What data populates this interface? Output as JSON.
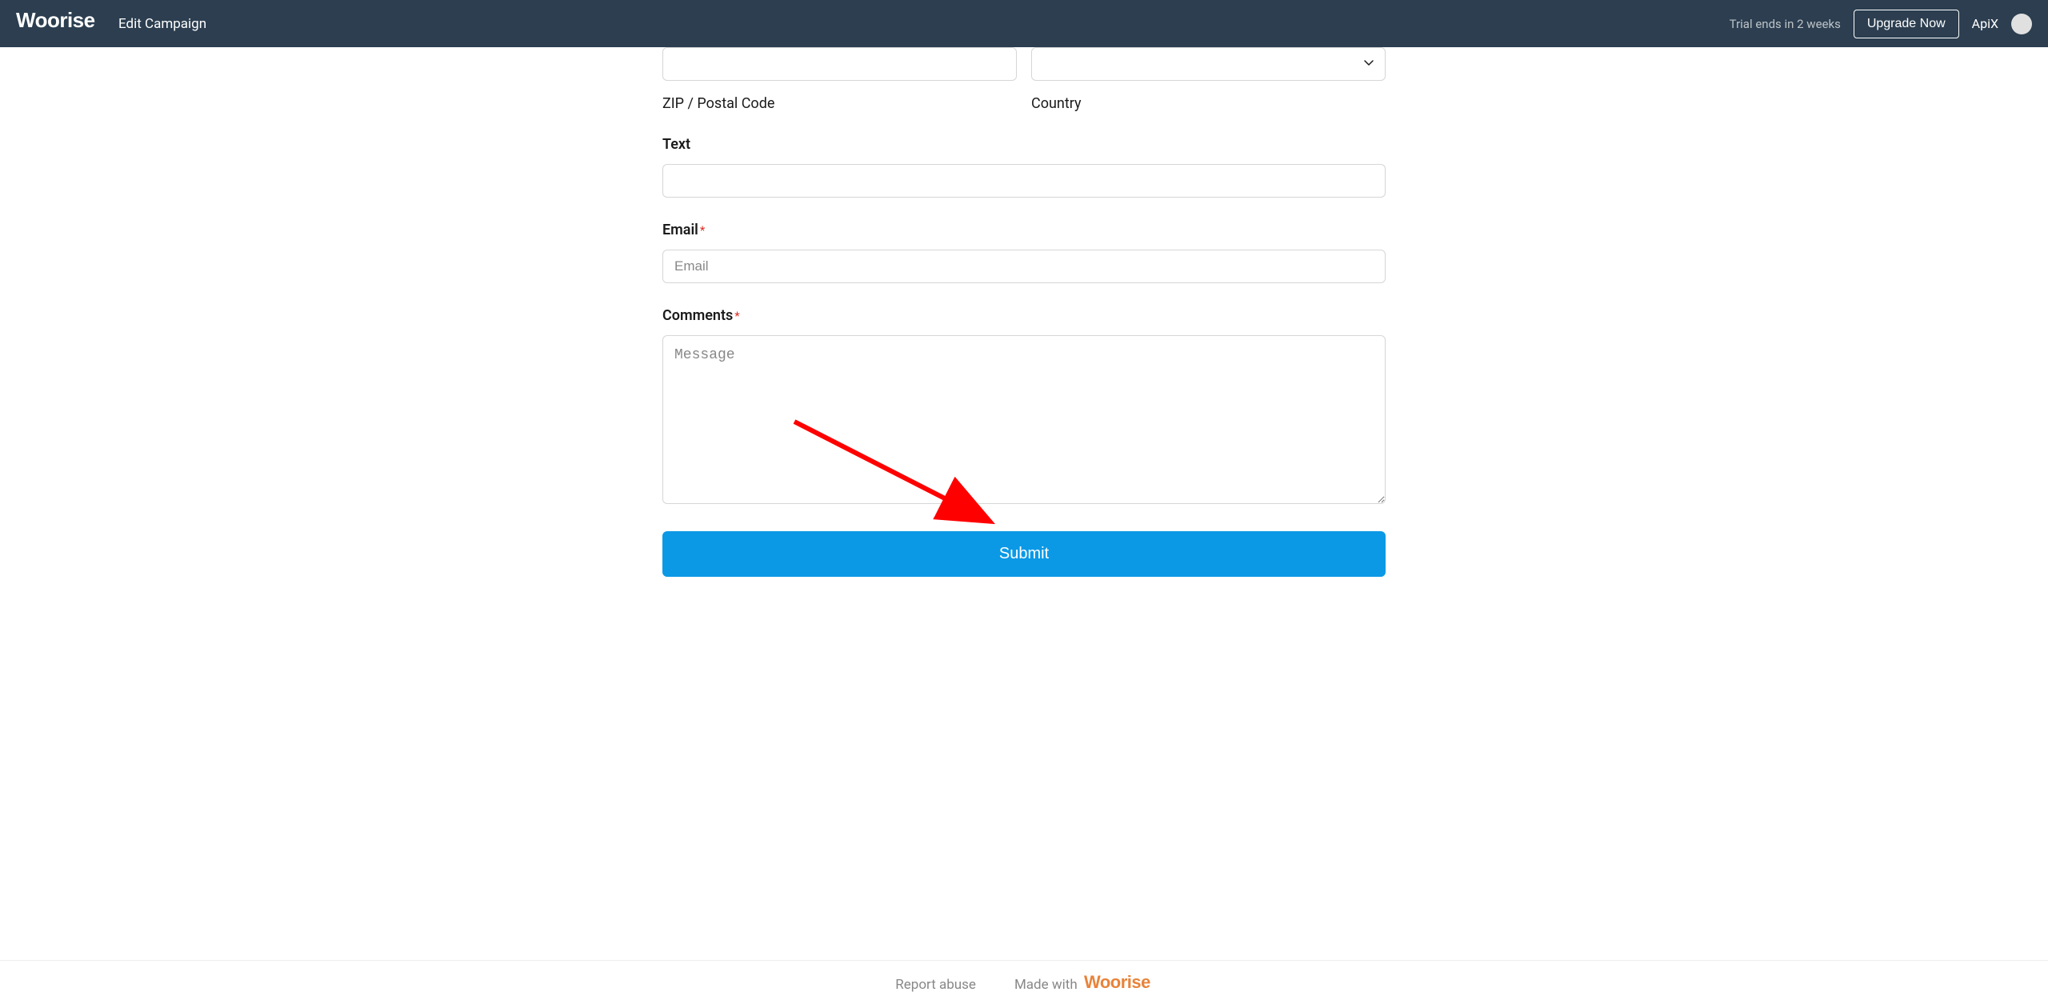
{
  "header": {
    "logo_text": "Woorise",
    "page_title": "Edit Campaign",
    "trial_text": "Trial ends in 2 weeks",
    "upgrade_label": "Upgrade Now",
    "user_name": "ApiX"
  },
  "form": {
    "zip_sublabel": "ZIP / Postal Code",
    "country_sublabel": "Country",
    "text_label": "Text",
    "email_label": "Email",
    "email_placeholder": "Email",
    "comments_label": "Comments",
    "comments_placeholder": "Message",
    "submit_label": "Submit",
    "required_marker": "*"
  },
  "footer": {
    "report_abuse": "Report abuse",
    "made_with": "Made with",
    "footer_logo": "Woorise"
  }
}
